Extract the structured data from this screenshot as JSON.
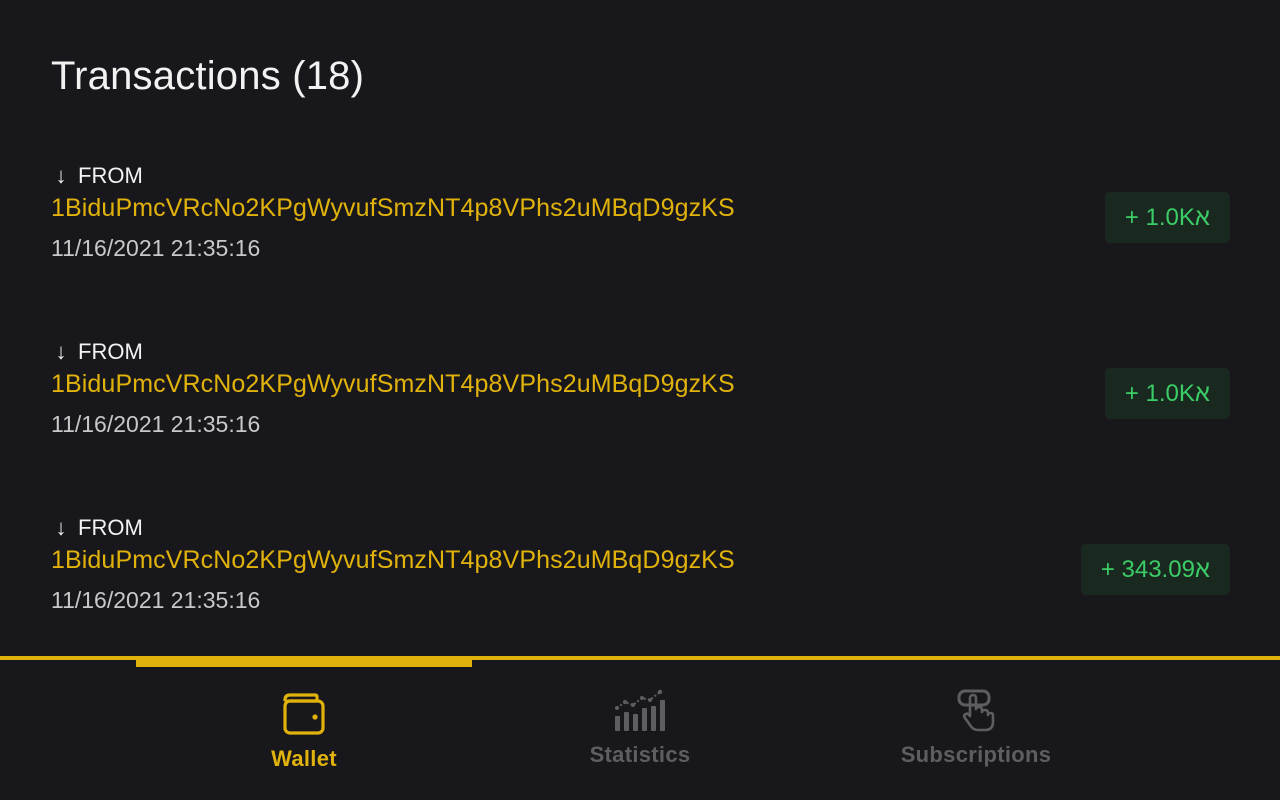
{
  "header": {
    "title": "Transactions (18)"
  },
  "transactions": [
    {
      "direction_icon": "arrow-down-icon",
      "direction": "FROM",
      "address": "1BiduPmcVRcNo2KPgWyvufSmzNT4p8VPhs2uMBqD9gzKS",
      "date": "11/16/2021 21:35:16",
      "amount": "+ 1.0Kא"
    },
    {
      "direction_icon": "arrow-down-icon",
      "direction": "FROM",
      "address": "1BiduPmcVRcNo2KPgWyvufSmzNT4p8VPhs2uMBqD9gzKS",
      "date": "11/16/2021 21:35:16",
      "amount": "+ 1.0Kא"
    },
    {
      "direction_icon": "arrow-down-icon",
      "direction": "FROM",
      "address": "1BiduPmcVRcNo2KPgWyvufSmzNT4p8VPhs2uMBqD9gzKS",
      "date": "11/16/2021 21:35:16",
      "amount": "+ 343.09א"
    }
  ],
  "nav": {
    "items": [
      {
        "label": "Wallet",
        "icon": "wallet-icon",
        "active": true
      },
      {
        "label": "Statistics",
        "icon": "statistics-icon",
        "active": false
      },
      {
        "label": "Subscriptions",
        "icon": "subscriptions-icon",
        "active": false
      }
    ]
  },
  "colors": {
    "background": "#18181c",
    "accent": "#e0b20b",
    "amount_text": "#3ccc67",
    "amount_bg": "#19291f",
    "inactive": "#5e5e62"
  }
}
